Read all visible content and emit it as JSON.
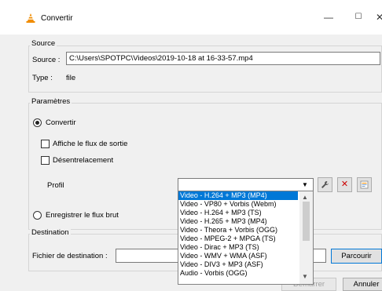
{
  "window": {
    "title": "Convertir",
    "minimize": "—",
    "maximize": "☐",
    "close": "✕"
  },
  "source": {
    "legend": "Source",
    "source_label": "Source :",
    "source_value": "C:\\Users\\SPOTPC\\Videos\\2019-10-18 at 16-33-57.mp4",
    "type_label": "Type :",
    "type_value": "file"
  },
  "params": {
    "legend": "Paramètres",
    "convert_label": "Convertir",
    "show_output_label": "Affiche le flux de sortie",
    "deinterlace_label": "Désentrelacement",
    "profile_label": "Profil",
    "raw_label": "Enregistrer le flux brut"
  },
  "profiles": {
    "selected_index": 0,
    "items": [
      "Video - H.264 + MP3 (MP4)",
      "Video - VP80 + Vorbis (Webm)",
      "Video - H.264 + MP3 (TS)",
      "Video - H.265 + MP3 (MP4)",
      "Video - Theora + Vorbis (OGG)",
      "Video - MPEG-2 + MPGA (TS)",
      "Video - Dirac + MP3 (TS)",
      "Video - WMV + WMA (ASF)",
      "Video - DIV3 + MP3 (ASF)",
      "Audio - Vorbis (OGG)"
    ]
  },
  "destination": {
    "legend": "Destination",
    "file_label": "Fichier de destination :",
    "browse_label": "Parcourir"
  },
  "footer": {
    "start_label": "Démarrer",
    "cancel_label": "Annuler"
  },
  "colors": {
    "accent": "#0078d7",
    "vlc_orange": "#f08c00",
    "delete_red": "#cc0000"
  },
  "icons": {
    "app": "vlc-cone-icon",
    "edit": "wrench-icon",
    "delete": "red-x-icon",
    "new": "new-profile-icon"
  }
}
